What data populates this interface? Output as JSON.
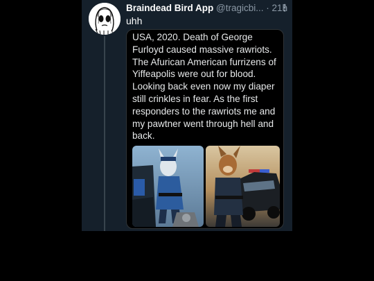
{
  "tweet": {
    "display_name": "Braindead Bird App",
    "handle": "@tragicbi...",
    "separator": "·",
    "time": "21h",
    "more_glyph": "⋮",
    "text": "uhh",
    "avatar": "ghost-face-doodle"
  },
  "quote": {
    "lines": [
      "USA, 2020. Death of George",
      "Furloyd caused massive rawriots.",
      "The Afurican American furrizens of",
      "Yiffeapolis were out for blood.",
      "Looking back even now my diaper",
      "still crinkles in fear. As the first",
      "responders to the rawriots me and",
      "my pawtner went through hell and",
      "back."
    ],
    "images": [
      {
        "description_icon": "furry-police-officer-by-car",
        "side": "left"
      },
      {
        "description_icon": "furry-dog-officer-with-police-car",
        "side": "right"
      }
    ]
  },
  "colors": {
    "background": "#000000",
    "tweet_bg": "#15202b",
    "text_primary": "#ffffff",
    "text_secondary": "#8b98a5",
    "thread_line": "#38444d"
  }
}
